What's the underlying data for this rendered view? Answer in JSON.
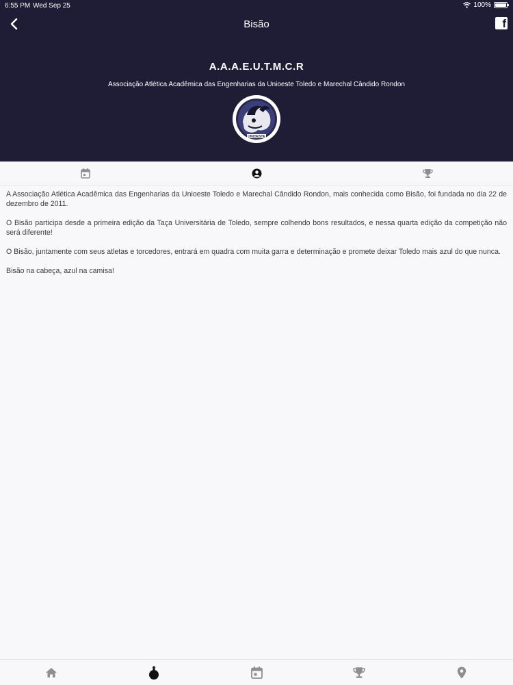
{
  "status_bar": {
    "time": "6:55 PM",
    "date": "Wed Sep 25",
    "battery": "100%"
  },
  "nav": {
    "title": "Bisão"
  },
  "club": {
    "acronym": "A.A.A.E.U.T.M.C.R",
    "full_name": "Associação Atlética Acadêmica das Engenharias da Unioeste Toledo e Marechal Cândido Rondon",
    "logo_text": "UNIOESTE"
  },
  "tabs": [
    {
      "icon": "calendar-icon",
      "active": false
    },
    {
      "icon": "profile-icon",
      "active": true
    },
    {
      "icon": "trophy-icon",
      "active": false
    }
  ],
  "content": {
    "paragraphs": [
      "A Associação Atlética Acadêmica das Engenharias da Unioeste Toledo e Marechal Cândido Rondon, mais conhecida como Bisão, foi fundada no dia 22 de dezembro de 2011.",
      "O Bisão participa desde a primeira edição da Taça Universitária de Toledo, sempre colhendo bons resultados, e nessa quarta edição da competição não será diferente!",
      "O Bisão, juntamente com seus atletas e torcedores, entrará em quadra com muita garra e determinação e promete deixar Toledo mais azul do que nunca.",
      "Bisão na cabeça, azul na camisa!"
    ]
  },
  "bottom_nav": [
    {
      "icon": "home-icon",
      "active": false
    },
    {
      "icon": "bomb-icon",
      "active": true
    },
    {
      "icon": "calendar-icon",
      "active": false
    },
    {
      "icon": "trophy-icon",
      "active": false
    },
    {
      "icon": "location-pin-icon",
      "active": false
    }
  ],
  "colors": {
    "header_bg": "#1f1d36",
    "active_icon": "#111111",
    "inactive_icon": "#8e8e90"
  }
}
